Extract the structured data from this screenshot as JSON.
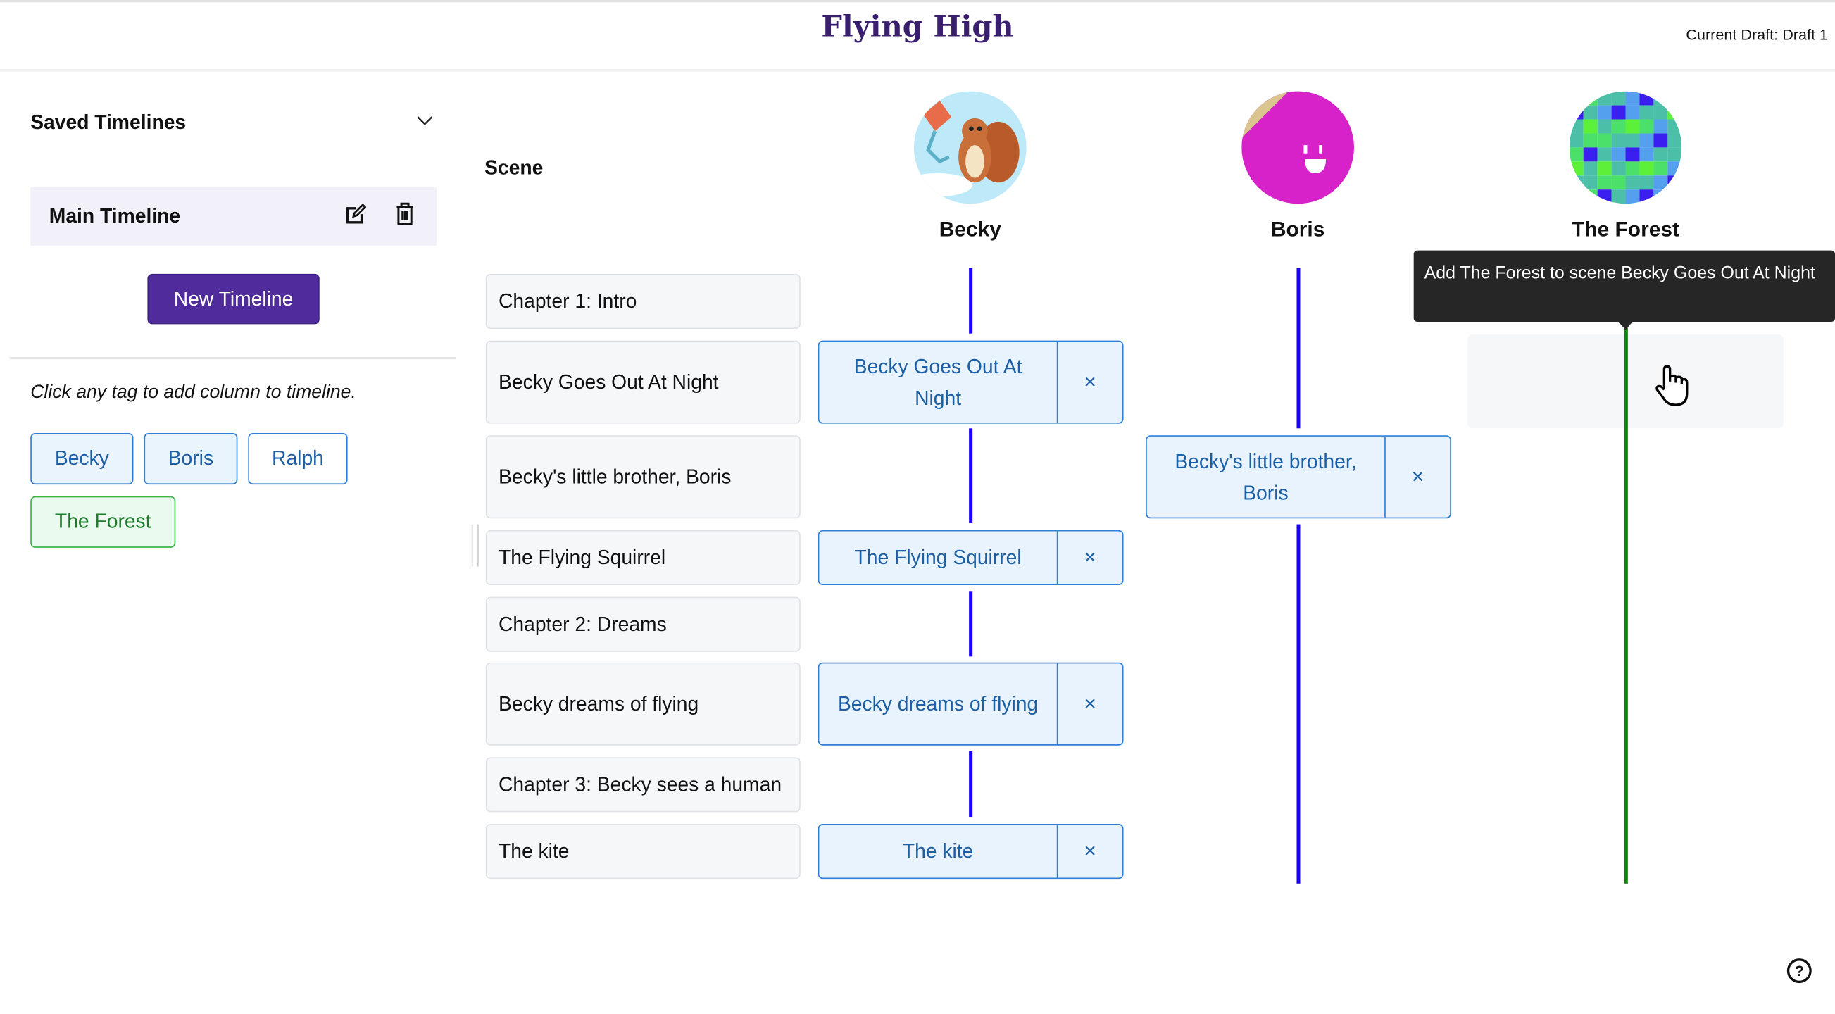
{
  "header": {
    "title": "Flying High",
    "draft": "Current Draft: Draft 1"
  },
  "sidebar": {
    "saved_title": "Saved Timelines",
    "timelines": [
      {
        "label": "Main Timeline"
      }
    ],
    "new_button": "New Timeline",
    "hint": "Click any tag to add column to timeline.",
    "tags": [
      {
        "label": "Becky",
        "color": "#1d5fa5"
      },
      {
        "label": "Boris",
        "color": "#1d5fa5"
      },
      {
        "label": "Ralph",
        "color": "#1d5fa5"
      },
      {
        "label": "The Forest",
        "color": "#1f7a2b"
      }
    ]
  },
  "timeline": {
    "scene_header": "Scene",
    "columns": [
      {
        "name": "Becky",
        "line_color": "#1a00ff"
      },
      {
        "name": "Boris",
        "line_color": "#1a00ff"
      },
      {
        "name": "The Forest",
        "line_color": "#078a07"
      }
    ],
    "scenes": [
      "Chapter 1: Intro",
      "Becky Goes Out At Night",
      "Becky's little brother, Boris",
      "The Flying Squirrel",
      "Chapter 2: Dreams",
      "Becky dreams of flying",
      "Chapter 3: Becky sees a human",
      "The kite"
    ],
    "cards": [
      {
        "column": "Becky",
        "label": "Becky Goes Out At Night",
        "remove": "×"
      },
      {
        "column": "Boris",
        "label": "Becky's little brother, Boris",
        "remove": "×"
      },
      {
        "column": "Becky",
        "label": "The Flying Squirrel",
        "remove": "×"
      },
      {
        "column": "Becky",
        "label": "Becky dreams of flying",
        "remove": "×"
      },
      {
        "column": "Becky",
        "label": "The kite",
        "remove": "×"
      }
    ],
    "tooltip": "Add The Forest to scene Becky Goes Out At Night"
  },
  "help": "?"
}
